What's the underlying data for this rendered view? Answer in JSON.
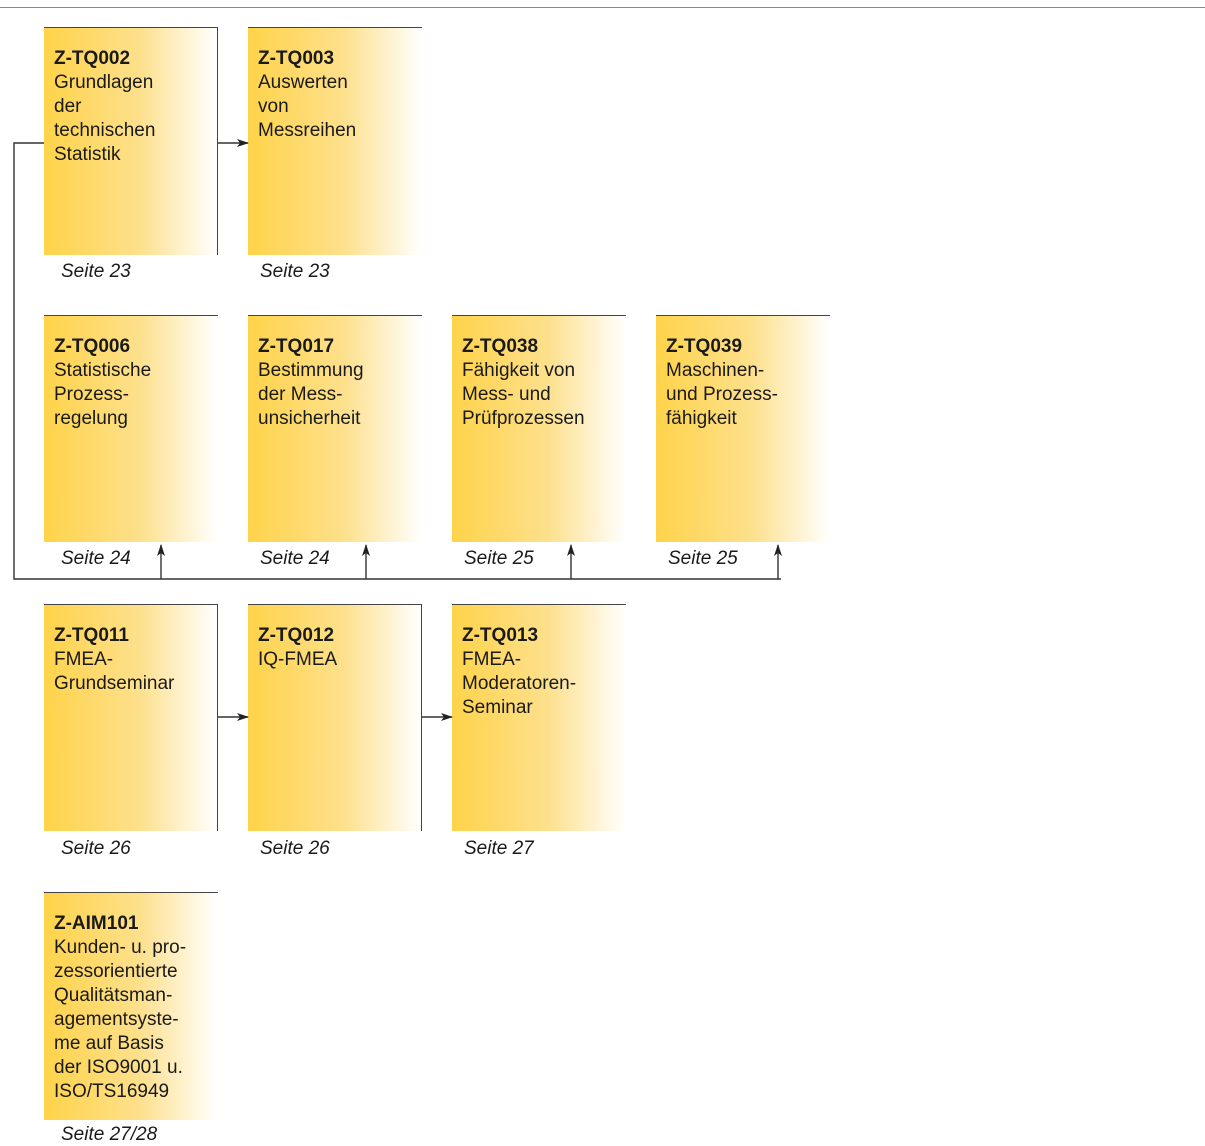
{
  "courses": [
    {
      "code": "Z-TQ002",
      "title": "Grundlagen\nder\ntechnischen\nStatistik",
      "page": "Seite 23"
    },
    {
      "code": "Z-TQ003",
      "title": "Auswerten\nvon\nMessreihen",
      "page": "Seite 23"
    },
    {
      "code": "Z-TQ006",
      "title": "Statistische\nProzess-\nregelung",
      "page": "Seite 24"
    },
    {
      "code": "Z-TQ017",
      "title": "Bestimmung\nder Mess-\nunsicherheit",
      "page": "Seite 24"
    },
    {
      "code": "Z-TQ038",
      "title": "Fähigkeit von\nMess- und\nPrüfprozessen",
      "page": "Seite 25"
    },
    {
      "code": "Z-TQ039",
      "title": "Maschinen-\nund Prozess-\nfähigkeit",
      "page": "Seite 25"
    },
    {
      "code": "Z-TQ011",
      "title": "FMEA-\nGrundseminar",
      "page": "Seite 26"
    },
    {
      "code": "Z-TQ012",
      "title": "IQ-FMEA",
      "page": "Seite 26"
    },
    {
      "code": "Z-TQ013",
      "title": "FMEA-\nModeratoren-\nSeminar",
      "page": "Seite 27"
    },
    {
      "code": "Z-AIM101",
      "title": "Kunden- u. pro-\nzessorientierte\nQualitätsman-\nagementsyste-\nme auf Basis\nder ISO9001 u.\nISO/TS16949",
      "page": "Seite 27/28"
    }
  ],
  "colors": {
    "card_gradient_start": "#ffd34a",
    "card_gradient_end": "#ffffff",
    "line": "#333333"
  }
}
